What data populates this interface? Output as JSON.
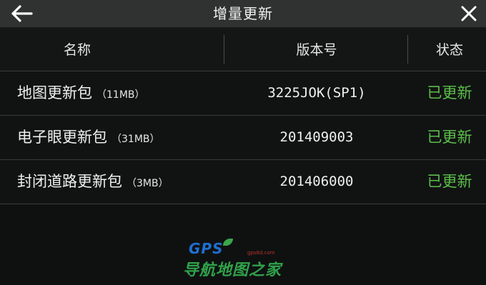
{
  "header": {
    "title": "增量更新",
    "back_icon": "arrow-left-icon",
    "close_icon": "close-icon"
  },
  "table": {
    "columns": [
      "名称",
      "版本号",
      "状态"
    ],
    "rows": [
      {
        "name": "地图更新包",
        "size": "（11MB）",
        "version": "3225JOK(SP1)",
        "status": "已更新"
      },
      {
        "name": "电子眼更新包",
        "size": "（31MB）",
        "version": "201409003",
        "status": "已更新"
      },
      {
        "name": "封闭道路更新包",
        "size": "（3MB）",
        "version": "201406000",
        "status": "已更新"
      }
    ]
  },
  "watermark": {
    "logo_text": "GPS",
    "url_text": "gps8d.com",
    "tagline": "导航地图之家"
  },
  "colors": {
    "status_green": "#5cbf4a",
    "titlebar_bg": "#303232",
    "body_bg": "#0f1111"
  }
}
